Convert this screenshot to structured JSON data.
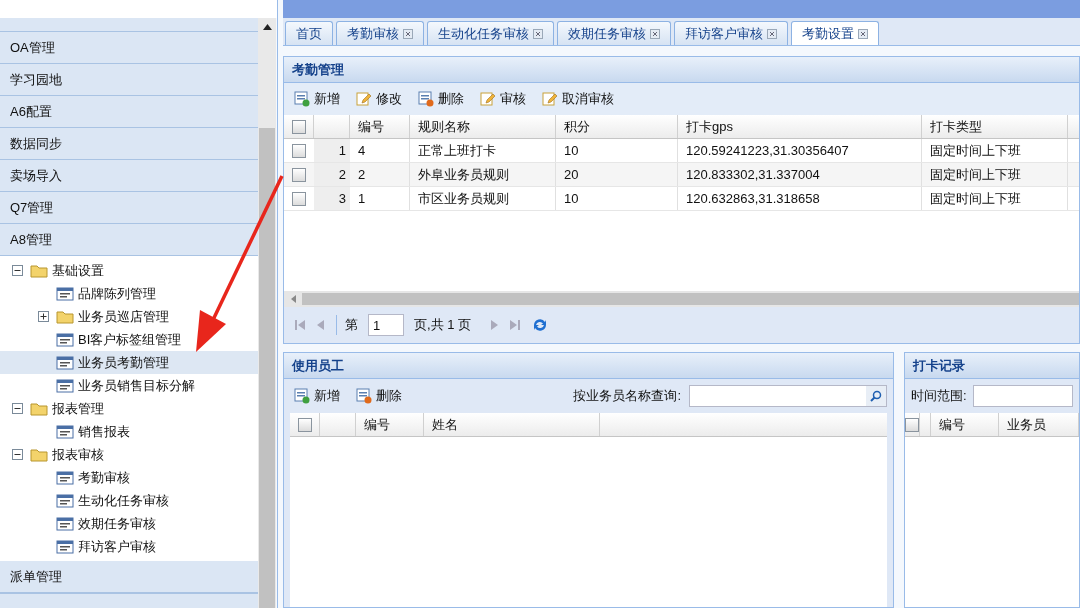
{
  "sidebar": {
    "sections_top": [
      {
        "label": "OA管理"
      },
      {
        "label": "学习园地"
      },
      {
        "label": "A6配置"
      },
      {
        "label": "数据同步"
      },
      {
        "label": "卖场导入"
      },
      {
        "label": "Q7管理"
      }
    ],
    "open_section": {
      "label": "A8管理",
      "tree": [
        {
          "kind": "folder",
          "label": "基础设置",
          "expanded": true,
          "selected": false,
          "children": [
            {
              "kind": "page",
              "label": "品牌陈列管理",
              "selected": false
            },
            {
              "kind": "folder",
              "label": "业务员巡店管理",
              "expanded": false,
              "selected": false
            },
            {
              "kind": "page",
              "label": "BI客户标签组管理",
              "selected": false
            },
            {
              "kind": "page",
              "label": "业务员考勤管理",
              "selected": true
            },
            {
              "kind": "page",
              "label": "业务员销售目标分解",
              "selected": false
            }
          ]
        },
        {
          "kind": "folder",
          "label": "报表管理",
          "expanded": true,
          "selected": false,
          "children": [
            {
              "kind": "page",
              "label": "销售报表",
              "selected": false
            }
          ]
        },
        {
          "kind": "folder",
          "label": "报表审核",
          "expanded": true,
          "selected": false,
          "children": [
            {
              "kind": "page",
              "label": "考勤审核",
              "selected": false
            },
            {
              "kind": "page",
              "label": "生动化任务审核",
              "selected": false
            },
            {
              "kind": "page",
              "label": "效期任务审核",
              "selected": false
            },
            {
              "kind": "page",
              "label": "拜访客户审核",
              "selected": false
            }
          ]
        }
      ]
    },
    "sections_bottom": [
      {
        "label": "派单管理"
      }
    ]
  },
  "tabs": [
    {
      "label": "首页",
      "closable": false,
      "selected": false
    },
    {
      "label": "考勤审核",
      "closable": true,
      "selected": false
    },
    {
      "label": "生动化任务审核",
      "closable": true,
      "selected": false
    },
    {
      "label": "效期任务审核",
      "closable": true,
      "selected": false
    },
    {
      "label": "拜访客户审核",
      "closable": true,
      "selected": false
    },
    {
      "label": "考勤设置",
      "closable": true,
      "selected": true
    }
  ],
  "main_panel": {
    "title": "考勤管理",
    "toolbar": [
      {
        "label": "新增",
        "kind": "add"
      },
      {
        "label": "修改",
        "kind": "edit"
      },
      {
        "label": "删除",
        "kind": "delete"
      },
      {
        "label": "审核",
        "kind": "edit"
      },
      {
        "label": "取消审核",
        "kind": "edit"
      }
    ],
    "columns": [
      "编号",
      "规则名称",
      "积分",
      "打卡gps",
      "打卡类型"
    ],
    "all_checked": false,
    "rows": [
      {
        "row_number": "1",
        "checked": false,
        "cells": [
          "4",
          "正常上班打卡",
          "10",
          "120.59241223,31.30356407",
          "固定时间上下班"
        ]
      },
      {
        "row_number": "2",
        "checked": false,
        "cells": [
          "2",
          "外阜业务员规则",
          "20",
          "120.833302,31.337004",
          "固定时间上下班"
        ]
      },
      {
        "row_number": "3",
        "checked": false,
        "cells": [
          "1",
          "市区业务员规则",
          "10",
          "120.632863,31.318658",
          "固定时间上下班"
        ]
      }
    ],
    "pager": {
      "before": "第",
      "page": "1",
      "after": "页,共 1 页"
    }
  },
  "employees_panel": {
    "title": "使用员工",
    "toolbar": [
      {
        "label": "新增",
        "kind": "add"
      },
      {
        "label": "删除",
        "kind": "delete"
      }
    ],
    "search_label": "按业务员名称查询:",
    "columns": [
      "编号",
      "姓名"
    ],
    "all_checked": false
  },
  "records_panel": {
    "title": "打卡记录",
    "range_label": "时间范围:",
    "columns": [
      "编号",
      "业务员"
    ],
    "all_checked": false
  }
}
